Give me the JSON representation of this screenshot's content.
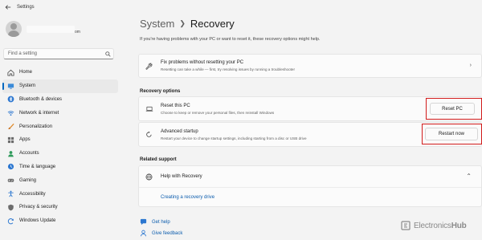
{
  "window": {
    "title": "Settings"
  },
  "profile": {
    "email_suffix": "om"
  },
  "search": {
    "placeholder": "Find a setting"
  },
  "sidebar": {
    "items": [
      {
        "label": "Home",
        "icon": "home-icon",
        "active": false
      },
      {
        "label": "System",
        "icon": "monitor-icon",
        "active": true
      },
      {
        "label": "Bluetooth & devices",
        "icon": "bluetooth-icon",
        "active": false
      },
      {
        "label": "Network & internet",
        "icon": "wifi-icon",
        "active": false
      },
      {
        "label": "Personalization",
        "icon": "brush-icon",
        "active": false
      },
      {
        "label": "Apps",
        "icon": "apps-icon",
        "active": false
      },
      {
        "label": "Accounts",
        "icon": "person-icon",
        "active": false
      },
      {
        "label": "Time & language",
        "icon": "globe-clock-icon",
        "active": false
      },
      {
        "label": "Gaming",
        "icon": "gamepad-icon",
        "active": false
      },
      {
        "label": "Accessibility",
        "icon": "accessibility-icon",
        "active": false
      },
      {
        "label": "Privacy & security",
        "icon": "shield-icon",
        "active": false
      },
      {
        "label": "Windows Update",
        "icon": "refresh-icon",
        "active": false
      }
    ]
  },
  "breadcrumb": {
    "parent": "System",
    "current": "Recovery"
  },
  "intro": "If you're having problems with your PC or want to reset it, these recovery options might help.",
  "fix_card": {
    "title": "Fix problems without resetting your PC",
    "subtitle": "Resetting can take a while — first, try resolving issues by running a troubleshooter"
  },
  "recovery_options": {
    "heading": "Recovery options",
    "reset": {
      "title": "Reset this PC",
      "subtitle": "Choose to keep or remove your personal files, then reinstall Windows",
      "button": "Reset PC"
    },
    "advanced": {
      "title": "Advanced startup",
      "subtitle": "Restart your device to change startup settings, including starting from a disc or USB drive",
      "button": "Restart now"
    }
  },
  "related_support": {
    "heading": "Related support",
    "help_title": "Help with Recovery",
    "link": "Creating a recovery drive"
  },
  "footer": {
    "get_help": "Get help",
    "give_feedback": "Give feedback"
  },
  "watermark": {
    "brand_light": "Electronics",
    "brand_bold": "Hub"
  },
  "colors": {
    "accent": "#0067c0",
    "highlight": "#d11b1b",
    "link": "#0b5cad"
  }
}
